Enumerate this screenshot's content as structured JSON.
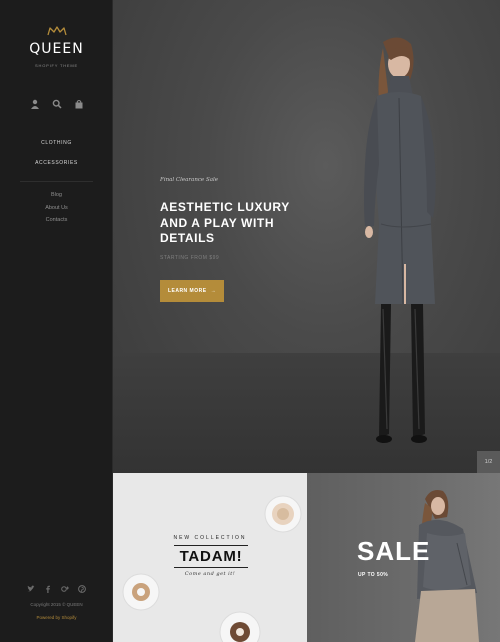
{
  "brand": {
    "name": "QUEEN",
    "tagline": "SHOPIFY THEME",
    "accent_color": "#b48c3a"
  },
  "utility_icons": [
    "user-icon",
    "search-icon",
    "cart-icon"
  ],
  "nav": {
    "main": [
      "CLOTHING",
      "ACCESSORIES"
    ],
    "secondary": [
      "Blog",
      "About Us",
      "Contacts"
    ]
  },
  "social_icons": [
    "twitter-icon",
    "facebook-icon",
    "google-plus-icon",
    "pinterest-icon"
  ],
  "footer": {
    "copyright": "Copyright 2015 © QUEEN",
    "powered": "Powered by Shopify"
  },
  "hero": {
    "eyebrow": "Final Clearance Sale",
    "headline_line1": "AESTHETIC LUXURY",
    "headline_line2": "AND A PLAY WITH",
    "headline_line3": "DETAILS",
    "starting": "STARTING FROM $99",
    "button_label": "LEARN MORE",
    "button_arrow": "→",
    "slide_counter": "1/2"
  },
  "promo_left": {
    "kicker": "NEW COLLECTION",
    "title": "TADAM!",
    "subtitle": "Come and get it!"
  },
  "promo_right": {
    "title": "SALE",
    "subtitle": "UP TO 50%"
  }
}
